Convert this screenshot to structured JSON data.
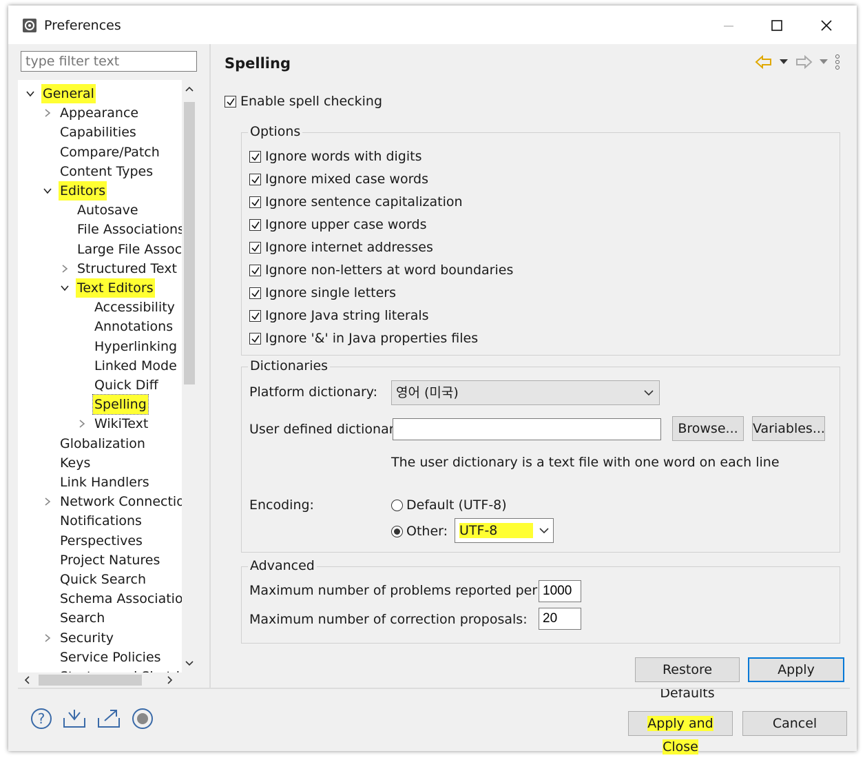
{
  "window": {
    "title": "Preferences"
  },
  "filter": {
    "placeholder": "type filter text"
  },
  "tree": [
    {
      "label": "General",
      "indent": 0,
      "expanded": true,
      "hasChildren": true,
      "highlight": true
    },
    {
      "label": "Appearance",
      "indent": 1,
      "hasChildren": true
    },
    {
      "label": "Capabilities",
      "indent": 1
    },
    {
      "label": "Compare/Patch",
      "indent": 1
    },
    {
      "label": "Content Types",
      "indent": 1
    },
    {
      "label": "Editors",
      "indent": 1,
      "expanded": true,
      "hasChildren": true,
      "highlight": true
    },
    {
      "label": "Autosave",
      "indent": 2
    },
    {
      "label": "File Associations",
      "indent": 2
    },
    {
      "label": "Large File Associa",
      "indent": 2
    },
    {
      "label": "Structured Text Ed",
      "indent": 2,
      "hasChildren": true
    },
    {
      "label": "Text Editors",
      "indent": 2,
      "expanded": true,
      "hasChildren": true,
      "highlight": true
    },
    {
      "label": "Accessibility",
      "indent": 3
    },
    {
      "label": "Annotations",
      "indent": 3
    },
    {
      "label": "Hyperlinking",
      "indent": 3
    },
    {
      "label": "Linked Mode",
      "indent": 3
    },
    {
      "label": "Quick Diff",
      "indent": 3
    },
    {
      "label": "Spelling",
      "indent": 3,
      "selected": true
    },
    {
      "label": "WikiText",
      "indent": 3,
      "hasChildren": true
    },
    {
      "label": "Globalization",
      "indent": 1
    },
    {
      "label": "Keys",
      "indent": 1
    },
    {
      "label": "Link Handlers",
      "indent": 1
    },
    {
      "label": "Network Connection",
      "indent": 1,
      "hasChildren": true
    },
    {
      "label": "Notifications",
      "indent": 1
    },
    {
      "label": "Perspectives",
      "indent": 1
    },
    {
      "label": "Project Natures",
      "indent": 1
    },
    {
      "label": "Quick Search",
      "indent": 1
    },
    {
      "label": "Schema Associations",
      "indent": 1
    },
    {
      "label": "Search",
      "indent": 1
    },
    {
      "label": "Security",
      "indent": 1,
      "hasChildren": true
    },
    {
      "label": "Service Policies",
      "indent": 1
    },
    {
      "label": "Startup and Shutdown",
      "indent": 1,
      "hasChildren": true
    }
  ],
  "page": {
    "title": "Spelling",
    "enable_label": "Enable spell checking",
    "options_title": "Options",
    "options": [
      "Ignore words with digits",
      "Ignore mixed case words",
      "Ignore sentence capitalization",
      "Ignore upper case words",
      "Ignore internet addresses",
      "Ignore non-letters at word boundaries",
      "Ignore single letters",
      "Ignore Java string literals",
      "Ignore '&' in Java properties files"
    ],
    "dictionaries_title": "Dictionaries",
    "platform_label": "Platform dictionary:",
    "platform_value": "영어 (미국)",
    "user_label": "User defined dictionary:",
    "user_value": "",
    "browse_label": "Browse...",
    "variables_label": "Variables...",
    "user_hint": "The user dictionary is a text file with one word on each line",
    "encoding_label": "Encoding:",
    "default_label": "Default (UTF-8)",
    "other_label": "Other:",
    "other_value": "UTF-8",
    "advanced_title": "Advanced",
    "max_problems_label": "Maximum number of problems reported per file:",
    "max_problems_value": "1000",
    "max_proposals_label": "Maximum number of correction proposals:",
    "max_proposals_value": "20",
    "restore_label": "Restore Defaults",
    "apply_label": "Apply"
  },
  "footer": {
    "apply_close_label": "Apply and Close",
    "cancel_label": "Cancel"
  },
  "icons": [
    "help-icon",
    "import-icon",
    "export-icon",
    "record-icon",
    "back-arrow-icon",
    "forward-arrow-icon",
    "view-menu-icon"
  ],
  "colors": {
    "highlight": "#ffff33",
    "default_button_border": "#0078d7",
    "nav_back": "#e0a800"
  }
}
